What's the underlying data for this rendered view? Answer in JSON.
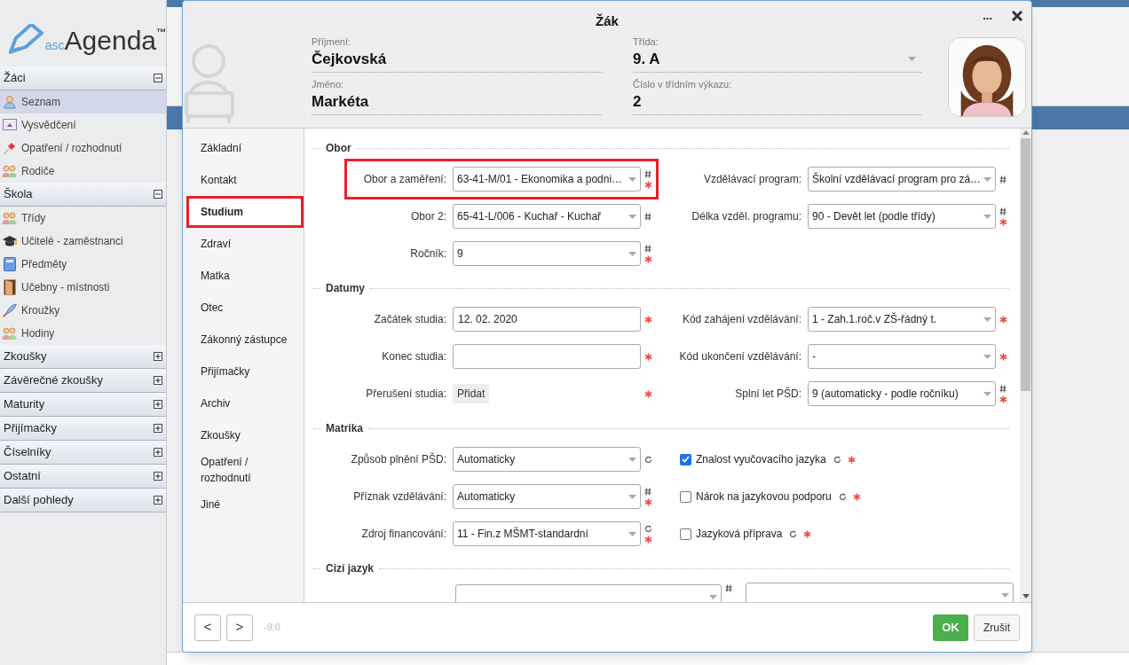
{
  "sidebar": {
    "logo": {
      "prefix": "asc",
      "name": "Agenda",
      "mark": "™"
    },
    "sections": [
      {
        "title": "Žáci",
        "expanded": true,
        "items": [
          {
            "label": "Seznam",
            "selected": true
          },
          {
            "label": "Vysvědčení",
            "selected": false
          },
          {
            "label": "Opatření / rozhodnutí",
            "selected": false
          },
          {
            "label": "Rodiče",
            "selected": false
          }
        ]
      },
      {
        "title": "Škola",
        "expanded": true,
        "items": [
          {
            "label": "Třídy",
            "selected": false
          },
          {
            "label": "Učitelé - zaměstnanci",
            "selected": false
          },
          {
            "label": "Předměty",
            "selected": false
          },
          {
            "label": "Učebny - místnosti",
            "selected": false
          },
          {
            "label": "Kroužky",
            "selected": false
          },
          {
            "label": "Hodiny",
            "selected": false
          }
        ]
      },
      {
        "title": "Zkoušky",
        "expanded": false
      },
      {
        "title": "Závěrečné zkoušky",
        "expanded": false
      },
      {
        "title": "Maturity",
        "expanded": false
      },
      {
        "title": "Přijímačky",
        "expanded": false
      },
      {
        "title": "Číselníky",
        "expanded": false
      },
      {
        "title": "Ostatní",
        "expanded": false
      },
      {
        "title": "Další pohledy",
        "expanded": false
      }
    ]
  },
  "modal": {
    "title": "Žák",
    "more": "...",
    "header_fields": [
      {
        "label": "Příjmení:",
        "value": "Čejkovská",
        "dropdown": false
      },
      {
        "label": "Třída:",
        "value": "9. A",
        "dropdown": true
      },
      {
        "label": "Jméno:",
        "value": "Markéta",
        "dropdown": false
      },
      {
        "label": "Číslo v třídním výkazu:",
        "value": "2",
        "dropdown": false
      }
    ],
    "nav": [
      {
        "label": "Základní",
        "selected": false,
        "highlighted": false
      },
      {
        "label": "Kontakt",
        "selected": false,
        "highlighted": false
      },
      {
        "label": "Studium",
        "selected": true,
        "highlighted": true
      },
      {
        "label": "Zdraví",
        "selected": false,
        "highlighted": false
      },
      {
        "label": "Matka",
        "selected": false,
        "highlighted": false
      },
      {
        "label": "Otec",
        "selected": false,
        "highlighted": false
      },
      {
        "label": "Zákonný zástupce",
        "selected": false,
        "highlighted": false
      },
      {
        "label": "Přijímačky",
        "selected": false,
        "highlighted": false
      },
      {
        "label": "Archiv",
        "selected": false,
        "highlighted": false
      },
      {
        "label": "Zkoušky",
        "selected": false,
        "highlighted": false
      },
      {
        "label": "Opatření / rozhodnutí",
        "selected": false,
        "highlighted": false
      },
      {
        "label": "Jiné",
        "selected": false,
        "highlighted": false
      }
    ],
    "sections": [
      {
        "title": "Obor",
        "rows": [
          {
            "left": {
              "kind": "select",
              "label": "Obor a zaměření:",
              "value": "63-41-M/01 - Ekonomika a podni…",
              "hash": true,
              "required": true,
              "refresh": false,
              "highlighted": true
            },
            "right": {
              "kind": "select",
              "label": "Vzdělávací program:",
              "value": "Školní vzdělávací program pro zá…",
              "hash": true,
              "required": false,
              "refresh": false,
              "highlighted": false
            }
          },
          {
            "left": {
              "kind": "select",
              "label": "Obor 2:",
              "value": "65-41-L/006 - Kuchař - Kuchař",
              "hash": true,
              "required": false,
              "refresh": false,
              "highlighted": false
            },
            "right": {
              "kind": "select",
              "label": "Délka vzděl. programu:",
              "value": "90 - Devět let (podle třídy)",
              "hash": true,
              "required": true,
              "refresh": false,
              "highlighted": false
            }
          },
          {
            "left": {
              "kind": "select",
              "label": "Ročník:",
              "value": "9",
              "hash": true,
              "required": true,
              "refresh": false,
              "highlighted": false
            }
          }
        ]
      },
      {
        "title": "Datumy",
        "rows": [
          {
            "left": {
              "kind": "input",
              "label": "Začátek studia:",
              "value": "12. 02. 2020",
              "hash": false,
              "required": true,
              "refresh": false,
              "highlighted": false
            },
            "right": {
              "kind": "select",
              "label": "Kód zahájení vzdělávání:",
              "value": "1 - Zah.1.roč.v ZŠ-řádný t.",
              "hash": false,
              "required": true,
              "refresh": false,
              "highlighted": false
            }
          },
          {
            "left": {
              "kind": "input",
              "label": "Konec studia:",
              "hash": false,
              "required": true,
              "refresh": false,
              "highlighted": false
            },
            "right": {
              "kind": "select",
              "label": "Kód ukončení vzdělávání:",
              "value": "-",
              "hash": false,
              "required": true,
              "refresh": false,
              "highlighted": false
            }
          },
          {
            "left": {
              "kind": "button",
              "label": "Přerušení studia:",
              "value": "Přidat",
              "hash": false,
              "required": true,
              "refresh": false,
              "highlighted": false
            },
            "right": {
              "kind": "select",
              "label": "Splní let PŠD:",
              "value": "9 (automaticky - podle ročníku)",
              "hash": true,
              "required": true,
              "refresh": false,
              "highlighted": false
            }
          }
        ]
      },
      {
        "title": "Matrika",
        "rows": [
          {
            "left": {
              "kind": "select",
              "label": "Způsob plnění PŠD:",
              "value": "Automaticky",
              "hash": false,
              "required": false,
              "refresh": true,
              "highlighted": false
            },
            "right": {
              "kind": "checkbox",
              "label": "Znalost vyučovacího jazyka",
              "checked": true,
              "required": true,
              "refresh": true
            }
          },
          {
            "left": {
              "kind": "select",
              "label": "Příznak vzdělávání:",
              "value": "Automaticky",
              "hash": true,
              "required": true,
              "refresh": false,
              "highlighted": false
            },
            "right": {
              "kind": "checkbox",
              "label": "Nárok na jazykovou podporu",
              "checked": false,
              "required": true,
              "refresh": true
            }
          },
          {
            "left": {
              "kind": "select",
              "label": "Zdroj financování:",
              "value": "11 - Fin.z MŠMT-standardní",
              "hash": false,
              "required": true,
              "refresh": true,
              "highlighted": false
            },
            "right": {
              "kind": "checkbox",
              "label": "Jazyková příprava",
              "checked": false,
              "required": true,
              "refresh": true
            }
          }
        ]
      },
      {
        "title": "Cizí jazyk",
        "rows": [
          {
            "left": {
              "kind": "wide",
              "hash": true
            }
          }
        ]
      }
    ],
    "footer": {
      "prev": "<",
      "next": ">",
      "position": "-9:0",
      "ok": "OK",
      "cancel": "Zrušit"
    }
  }
}
